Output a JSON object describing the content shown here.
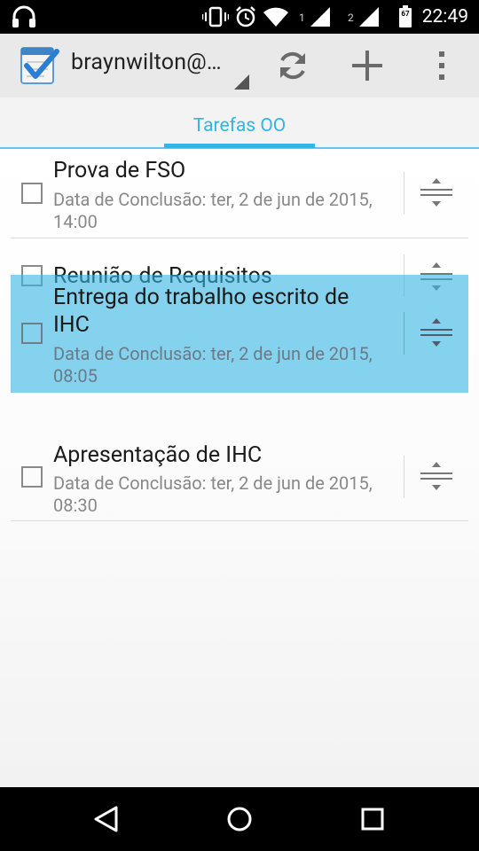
{
  "status_bar": {
    "time": "22:49",
    "battery_level": "67",
    "signal_1_label": "1",
    "signal_2_label": "2",
    "icons": [
      "headphones-icon",
      "vibrate-icon",
      "alarm-icon",
      "wifi-icon",
      "signal-icon",
      "signal-icon",
      "battery-icon"
    ]
  },
  "action_bar": {
    "account": "braynwilton@…",
    "icons": [
      "app-logo-icon",
      "sync-icon",
      "add-icon",
      "overflow-menu-icon"
    ]
  },
  "tabs": [
    {
      "label": "Tarefas OO",
      "selected": true
    }
  ],
  "tasks": [
    {
      "title": "Prova de FSO",
      "date_line1": "Data de Conclusão: ter, 2 de jun de 2015,",
      "date_line2": "14:00"
    },
    {
      "title": "Reunião de Requisitos"
    },
    {
      "title_line1": "Entrega do trabalho escrito de",
      "title_line2": "IHC",
      "date_line1": "Data de Conclusão: ter, 2 de jun de 2015,",
      "date_line2": "08:05",
      "dragging": true
    },
    {
      "title": "Apresentação de IHC",
      "date_line1": "Data de Conclusão: ter, 2 de jun de 2015,",
      "date_line2": "08:30"
    }
  ],
  "colors": {
    "accent": "#33b5e5",
    "action_bar": "#e9e9e9",
    "drag_highlight": "#33b5e5"
  },
  "nav_bar": {
    "icons": [
      "back-icon",
      "home-icon",
      "recents-icon"
    ]
  }
}
